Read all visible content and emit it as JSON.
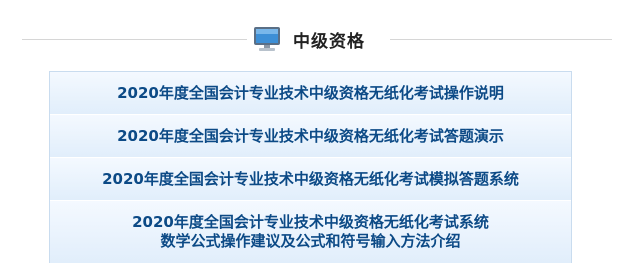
{
  "section": {
    "title": "中级资格",
    "icon": "computer-monitor-icon"
  },
  "items": [
    {
      "label": "2020年度全国会计专业技术中级资格无纸化考试操作说明"
    },
    {
      "label": "2020年度全国会计专业技术中级资格无纸化考试答题演示"
    },
    {
      "label": "2020年度全国会计专业技术中级资格无纸化考试模拟答题系统"
    },
    {
      "label_line1": "2020年度全国会计专业技术中级资格无纸化考试系统",
      "label_line2": "数学公式操作建议及公式和符号输入方法介绍"
    }
  ],
  "colors": {
    "link_text": "#0c4a86",
    "item_bg_top": "#f4f9ff",
    "item_bg_bottom": "#e1eefb",
    "border": "#c9dcef"
  }
}
